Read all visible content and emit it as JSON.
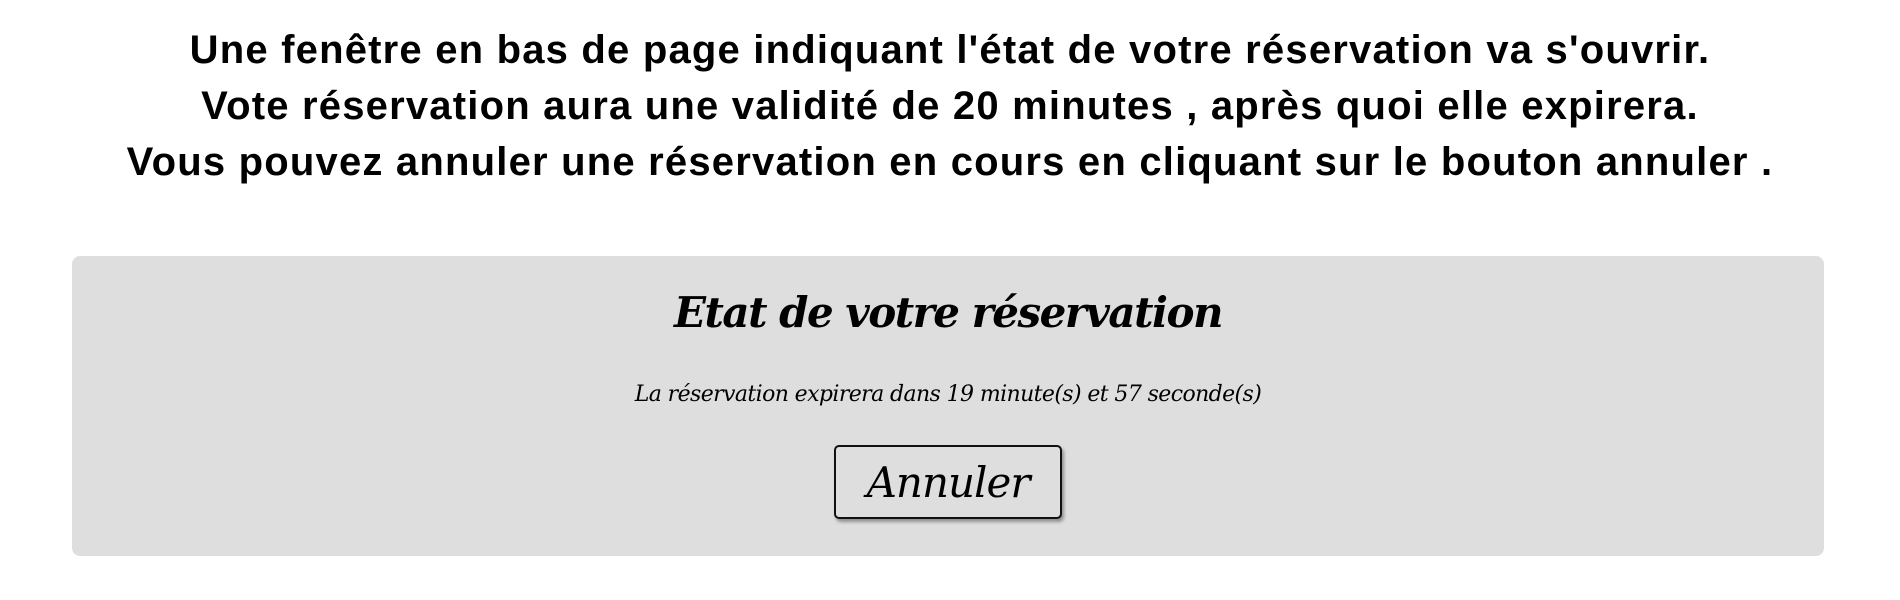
{
  "instructions": {
    "line1": "Une fenêtre en bas de page indiquant l'état de votre réservation va s'ouvrir.",
    "line2": "Vote réservation aura une validité de 20 minutes , après quoi elle expirera.",
    "line3": "Vous pouvez annuler une réservation en cours en cliquant sur le bouton annuler ."
  },
  "reservation_panel": {
    "title": "Etat de votre réservation",
    "status_text": "La réservation expirera dans 19 minute(s) et 57 seconde(s)",
    "cancel_label": "Annuler"
  },
  "colors": {
    "panel_background": "#dedede",
    "text": "#000000",
    "page_background": "#ffffff"
  }
}
